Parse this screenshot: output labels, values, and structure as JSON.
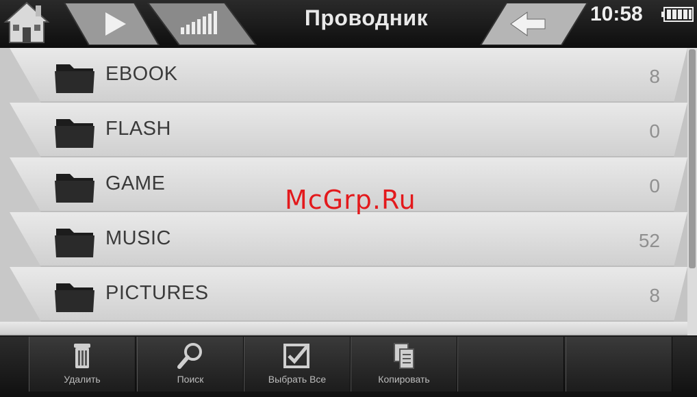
{
  "header": {
    "title": "Проводник",
    "time": "10:58",
    "icons": {
      "home": "home-icon",
      "play": "play-icon",
      "volume": "volume-icon",
      "back": "back-arrow-icon",
      "battery": "battery-icon"
    }
  },
  "list": {
    "items": [
      {
        "name": "EBOOK",
        "count": "8"
      },
      {
        "name": "FLASH",
        "count": "0"
      },
      {
        "name": "GAME",
        "count": "0"
      },
      {
        "name": "MUSIC",
        "count": "52"
      },
      {
        "name": "PICTURES",
        "count": "8"
      }
    ],
    "item_icon": "folder-icon"
  },
  "watermark": "McGrp.Ru",
  "toolbar": {
    "buttons": [
      {
        "label": "Удалить",
        "icon": "trash-icon"
      },
      {
        "label": "Поиск",
        "icon": "search-icon"
      },
      {
        "label": "Выбрать Все",
        "icon": "checkbox-icon"
      },
      {
        "label": "Копировать",
        "icon": "copy-icon"
      },
      {
        "label": "",
        "icon": ""
      },
      {
        "label": "",
        "icon": ""
      }
    ]
  },
  "colors": {
    "watermark": "#e3191c",
    "list_bg": "#dcdcdc",
    "bar_bg": "#1a1a1a"
  }
}
